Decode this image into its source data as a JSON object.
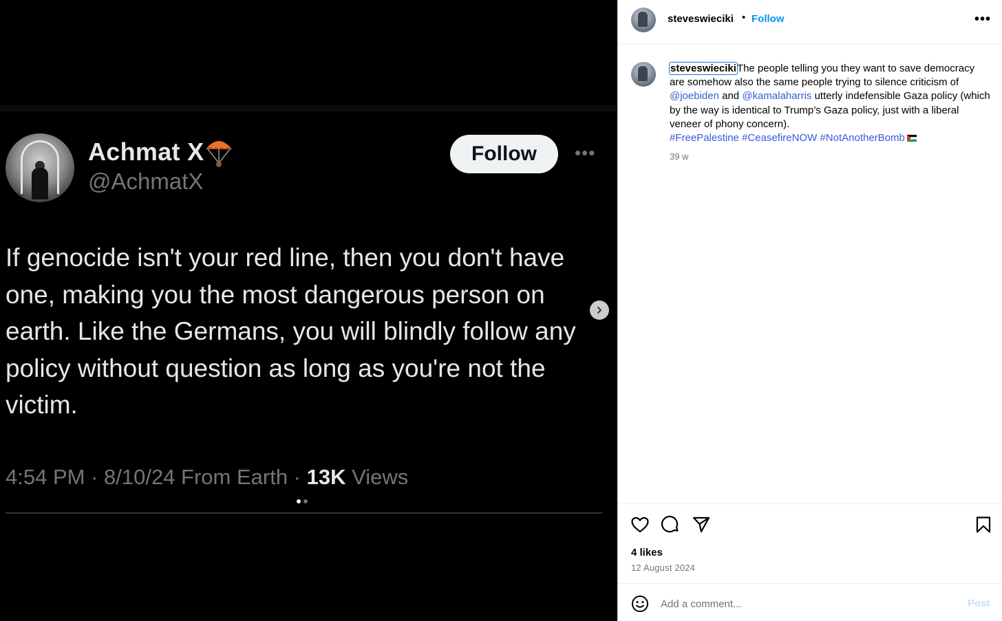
{
  "tweet": {
    "name": "Achmat X",
    "handle": "@AchmatX",
    "follow_label": "Follow",
    "more_label": "•••",
    "body": "If genocide isn't your red line, then you don't have one, making you the most dangerous person on earth. Like the Germans, you will blindly follow any policy without question as long as you're not the victim.",
    "meta_prefix": "4:54 PM · 8/10/24 From Earth · ",
    "views_count": "13K",
    "views_label": " Views"
  },
  "carousel": {
    "slides": 2,
    "active_slide": 1,
    "next_icon": "chevron-right-icon"
  },
  "header": {
    "username": "steveswieciki",
    "separator": "•",
    "follow_label": "Follow",
    "menu_label": "•••"
  },
  "caption": {
    "username": "steveswieciki",
    "text_1": "The people telling you they want to save democracy are somehow also the same people trying to silence criticism of ",
    "mention_1": "@joebiden",
    "text_2": " and ",
    "mention_2": "@kamalaharris",
    "text_3": " utterly indefensible Gaza policy (which by the way is identical to Trump’s Gaza policy, just with a liberal veneer of phony concern).",
    "hashtag_1": "#FreePalestine",
    "hashtag_2": "#CeasefireNOW",
    "hashtag_3": "#NotAnotherBomb",
    "time_ago": "39 w"
  },
  "actions": {
    "icons": [
      "heart-icon",
      "comment-icon",
      "share-icon",
      "bookmark-icon"
    ],
    "likes": "4 likes",
    "date": "12 August 2024"
  },
  "comment": {
    "placeholder": "Add a comment...",
    "post_label": "Post"
  },
  "colors": {
    "link_blue": "#0095f6",
    "mention_blue": "#3b59d6",
    "tweet_bg": "#000000",
    "tweet_text": "#e7e7e7",
    "tweet_muted": "#71767b"
  }
}
